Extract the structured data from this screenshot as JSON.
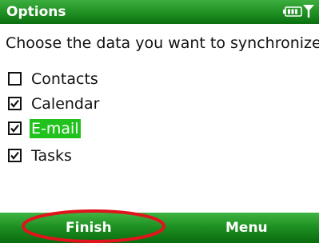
{
  "title_bar": {
    "title": "Options",
    "battery_icon": "battery-icon",
    "signal_icon": "signal-antenna-icon"
  },
  "prompt": "Choose the data you want to synchronize:",
  "items": [
    {
      "label": "Contacts",
      "checked": false,
      "highlighted": false
    },
    {
      "label": "Calendar",
      "checked": true,
      "highlighted": false
    },
    {
      "label": "E-mail",
      "checked": true,
      "highlighted": true
    },
    {
      "label": "Tasks",
      "checked": true,
      "highlighted": false
    }
  ],
  "softkeys": {
    "left": "Finish",
    "right": "Menu"
  },
  "colors": {
    "bar_green": "#1f8f22",
    "highlight_green": "#22c21e",
    "annotation_red": "#e0141c"
  }
}
